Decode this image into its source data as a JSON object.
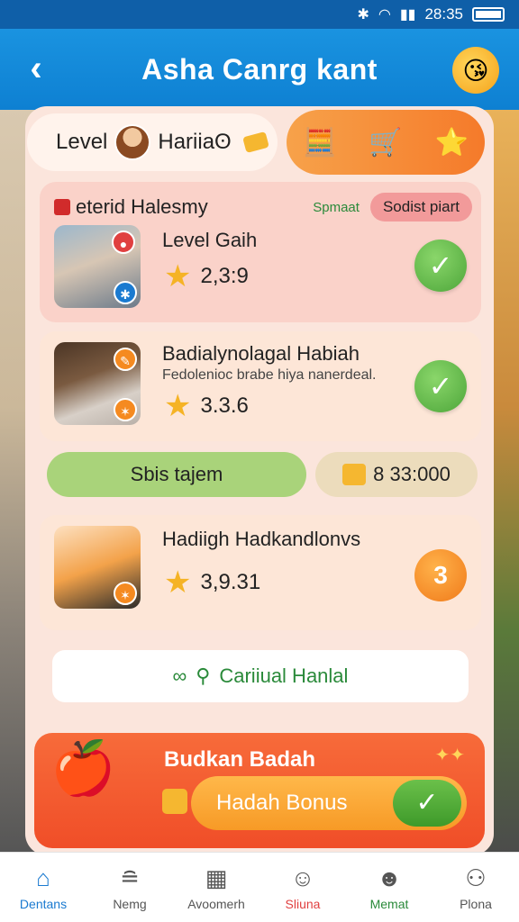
{
  "status_bar": {
    "time": "28:35",
    "bluetooth_icon": "bluetooth-icon",
    "wifi_icon": "wifi-icon",
    "signal_icon": "signal-icon",
    "battery_icon": "battery-icon"
  },
  "header": {
    "title": "Asha Canrg kant",
    "back_icon": "back-arrow-icon",
    "emoji_icon": "emoji-icon"
  },
  "level": {
    "label": "Level",
    "name": "Hariiaʘ"
  },
  "section": {
    "title": "eterid Halesmy",
    "link": "Spmaat",
    "sort_button": "Sodist piart"
  },
  "items": [
    {
      "title": "Level Gaih",
      "subtitle": "",
      "rating": "2,3:9",
      "action": "✓"
    },
    {
      "title": "Badialynolagal Habiah",
      "subtitle": "Fedolenioc brabe hiya nanerdeal.",
      "rating": "3.3.6",
      "action": "✓"
    },
    {
      "title": "Hadiigh Hadkandlonvs",
      "subtitle": "",
      "rating": "3,9.31",
      "action": "3"
    }
  ],
  "action_row": {
    "primary": "Sbis tajem",
    "coins": "8 33:000"
  },
  "hint": {
    "text": "Cariiual Hanlal"
  },
  "bonus": {
    "title": "Budkan Badah",
    "button": "Hadah Bonus"
  },
  "nav": [
    {
      "label": "Dentans",
      "icon": "home-icon"
    },
    {
      "label": "Nemg",
      "icon": "burger-icon"
    },
    {
      "label": "Avoomerh",
      "icon": "calendar-icon"
    },
    {
      "label": "Sliuna",
      "icon": "cat-icon"
    },
    {
      "label": "Memat",
      "icon": "cat-face-icon"
    },
    {
      "label": "Plona",
      "icon": "person-icon"
    }
  ],
  "colors": {
    "header": "#0e80d2",
    "panel": "#fbe5dc",
    "check": "#4da63a",
    "bonus": "#f04e28"
  }
}
